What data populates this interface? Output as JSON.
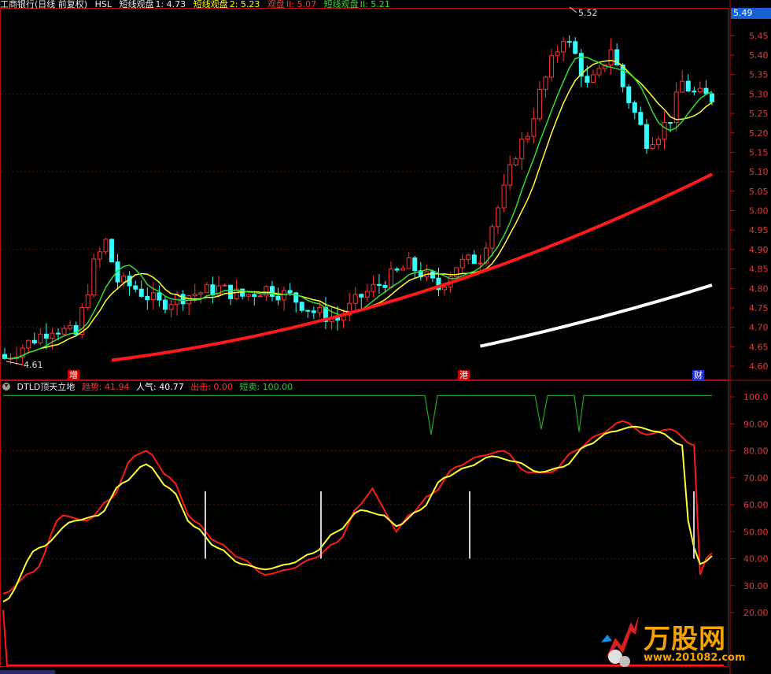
{
  "header": {
    "title": "工商银行(日线 前复权)",
    "indicator_name": "HSL",
    "items": [
      {
        "label": "短线观盘",
        "value": "1: 4.73",
        "color": "#e8e8e8"
      },
      {
        "label": "短线观盘",
        "value": "2: 5.23",
        "color": "#ffff00"
      },
      {
        "label": "观盘",
        "value": "II: 5.07",
        "color": "#ff3333"
      },
      {
        "label": "短线观盘",
        "value": "II: 5.21",
        "color": "#33dd33"
      }
    ]
  },
  "price_tag": "5.49",
  "price_axis": [
    "5.45",
    "5.40",
    "5.35",
    "5.30",
    "5.25",
    "5.20",
    "5.15",
    "5.10",
    "5.05",
    "5.00",
    "4.95",
    "4.90",
    "4.85",
    "4.80",
    "4.75",
    "4.70",
    "4.65",
    "4.60"
  ],
  "annotations": {
    "high": "5.52",
    "low": "4.61"
  },
  "events": [
    {
      "label": "增",
      "color": "#cc0000"
    },
    {
      "label": "港",
      "color": "#cc0000"
    },
    {
      "label": "财",
      "color": "#2233cc"
    }
  ],
  "indicator": {
    "name": "DTLD顶天立地",
    "items": [
      {
        "label": "趋势",
        "value": "41.94",
        "color": "#ff3333"
      },
      {
        "label": "人气",
        "value": "40.77",
        "color": "#ffffff"
      },
      {
        "label": "出击",
        "value": "0.00",
        "color": "#ff3333"
      },
      {
        "label": "短卖",
        "value": "100.00",
        "color": "#33cc33"
      }
    ]
  },
  "indicator_axis": [
    "100.0",
    "90.00",
    "80.00",
    "70.00",
    "60.00",
    "50.00",
    "40.00",
    "30.00",
    "20.00"
  ],
  "watermark": {
    "brand": "万股网",
    "url": "www.201082.com"
  },
  "colors": {
    "up": "#ff3333",
    "down": "#33ffff",
    "ma1": "#ffff33",
    "ma2": "#33dd33",
    "ma3": "#ff1a1a",
    "ma4": "#ffffff",
    "axis": "#b01010"
  }
}
